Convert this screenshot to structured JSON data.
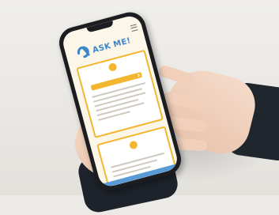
{
  "photo": {
    "subject": "hands-holding-smartphone"
  },
  "app": {
    "logo_subtitle": "",
    "logo_text": "ASK ME!",
    "brand_color": "#3d86c9",
    "accent_color": "#f2b631"
  },
  "status_bar": {
    "time": "",
    "icons": ""
  },
  "cards": [
    {
      "title": "",
      "icon": "circle-icon",
      "has_button": true
    },
    {
      "title": "",
      "icon": "circle-icon",
      "has_button": false
    }
  ]
}
